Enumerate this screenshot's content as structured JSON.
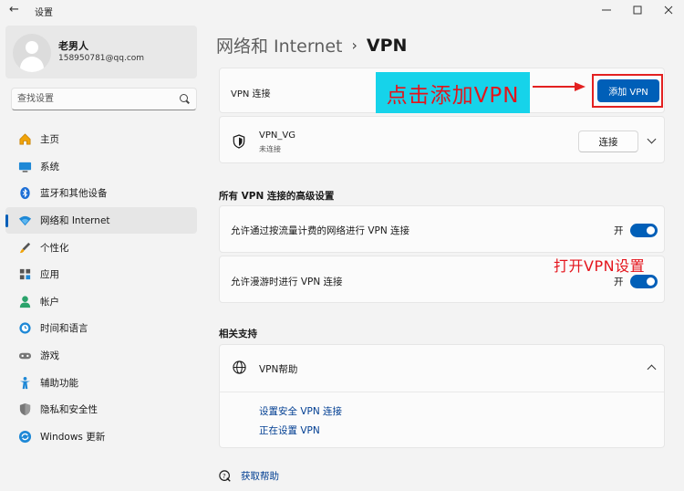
{
  "window": {
    "title": "设置",
    "back_icon": "arrow-left-icon",
    "controls": [
      "minimize-icon",
      "maximize-icon",
      "close-icon"
    ]
  },
  "profile": {
    "name": "老男人",
    "email": "158950781@qq.com"
  },
  "search": {
    "placeholder": "查找设置"
  },
  "sidebar": {
    "items": [
      {
        "label": "主页",
        "icon": "home-icon",
        "active": false
      },
      {
        "label": "系统",
        "icon": "monitor-icon",
        "active": false
      },
      {
        "label": "蓝牙和其他设备",
        "icon": "bluetooth-icon",
        "active": false
      },
      {
        "label": "网络和 Internet",
        "icon": "wifi-icon",
        "active": true
      },
      {
        "label": "个性化",
        "icon": "brush-icon",
        "active": false
      },
      {
        "label": "应用",
        "icon": "apps-icon",
        "active": false
      },
      {
        "label": "帐户",
        "icon": "person-icon",
        "active": false
      },
      {
        "label": "时间和语言",
        "icon": "clock-globe-icon",
        "active": false
      },
      {
        "label": "游戏",
        "icon": "gamepad-icon",
        "active": false
      },
      {
        "label": "辅助功能",
        "icon": "accessibility-icon",
        "active": false
      },
      {
        "label": "隐私和安全性",
        "icon": "shield-icon",
        "active": false
      },
      {
        "label": "Windows 更新",
        "icon": "update-icon",
        "active": false
      }
    ]
  },
  "breadcrumb": {
    "parent": "网络和 Internet",
    "separator": "›",
    "current": "VPN"
  },
  "vpn_connections": {
    "label": "VPN 连接",
    "add_button": "添加 VPN"
  },
  "vpn_entry": {
    "name": "VPN_VG",
    "status": "未连接",
    "connect_button": "连接"
  },
  "advanced": {
    "title": "所有 VPN 连接的高级设置",
    "options": [
      {
        "label": "允许通过按流量计费的网络进行 VPN 连接",
        "state": "开",
        "on": true
      },
      {
        "label": "允许漫游时进行 VPN 连接",
        "state": "开",
        "on": true
      }
    ]
  },
  "related": {
    "title": "相关支持",
    "help_title": "VPN帮助",
    "links": [
      "设置安全 VPN 连接",
      "正在设置 VPN"
    ]
  },
  "get_help": "获取帮助",
  "annotations": {
    "add_vpn_hint": "点击添加VPN",
    "toggle_hint": "打开VPN设置"
  },
  "colors": {
    "accent": "#005fb8",
    "annotation_red": "#e4141c",
    "annotation_bg": "#16d3ea",
    "link": "#003e92"
  }
}
